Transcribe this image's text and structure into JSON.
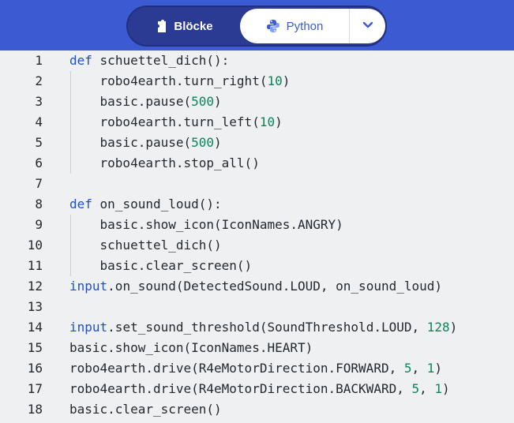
{
  "toolbar": {
    "blocks_label": "Blöcke",
    "python_label": "Python"
  },
  "editor": {
    "lines": [
      {
        "n": "1",
        "i": 0,
        "t": [
          [
            "kw",
            "def"
          ],
          [
            "",
            "schuettel_dich():"
          ]
        ]
      },
      {
        "n": "2",
        "i": 1,
        "t": [
          [
            "",
            "robo4earth.turn_right("
          ],
          [
            "num",
            "10"
          ],
          [
            "",
            ")"
          ]
        ]
      },
      {
        "n": "3",
        "i": 1,
        "t": [
          [
            "",
            "basic.pause("
          ],
          [
            "num",
            "500"
          ],
          [
            "",
            ")"
          ]
        ]
      },
      {
        "n": "4",
        "i": 1,
        "t": [
          [
            "",
            "robo4earth.turn_left("
          ],
          [
            "num",
            "10"
          ],
          [
            "",
            ")"
          ]
        ]
      },
      {
        "n": "5",
        "i": 1,
        "t": [
          [
            "",
            "basic.pause("
          ],
          [
            "num",
            "500"
          ],
          [
            "",
            ")"
          ]
        ]
      },
      {
        "n": "6",
        "i": 1,
        "t": [
          [
            "",
            "robo4earth.stop_all()"
          ]
        ]
      },
      {
        "n": "7",
        "i": 0,
        "t": []
      },
      {
        "n": "8",
        "i": 0,
        "t": [
          [
            "kw",
            "def"
          ],
          [
            "",
            "on_sound_loud():"
          ]
        ]
      },
      {
        "n": "9",
        "i": 1,
        "t": [
          [
            "",
            "basic.show_icon(IconNames.ANGRY)"
          ]
        ]
      },
      {
        "n": "10",
        "i": 1,
        "t": [
          [
            "",
            "schuettel_dich()"
          ]
        ]
      },
      {
        "n": "11",
        "i": 1,
        "t": [
          [
            "",
            "basic.clear_screen()"
          ]
        ]
      },
      {
        "n": "12",
        "i": 0,
        "t": [
          [
            "kw",
            "input"
          ],
          [
            "",
            ".on_sound(DetectedSound.LOUD, on_sound_loud)"
          ]
        ]
      },
      {
        "n": "13",
        "i": 0,
        "t": []
      },
      {
        "n": "14",
        "i": 0,
        "t": [
          [
            "kw",
            "input"
          ],
          [
            "",
            ".set_sound_threshold(SoundThreshold.LOUD, "
          ],
          [
            "num",
            "128"
          ],
          [
            "",
            ")"
          ]
        ]
      },
      {
        "n": "15",
        "i": 0,
        "t": [
          [
            "",
            "basic.show_icon(IconNames.HEART)"
          ]
        ]
      },
      {
        "n": "16",
        "i": 0,
        "t": [
          [
            "",
            "robo4earth.drive(R4eMotorDirection.FORWARD, "
          ],
          [
            "num",
            "5"
          ],
          [
            "",
            ", "
          ],
          [
            "num",
            "1"
          ],
          [
            "",
            ")"
          ]
        ]
      },
      {
        "n": "17",
        "i": 0,
        "t": [
          [
            "",
            "robo4earth.drive(R4eMotorDirection.BACKWARD, "
          ],
          [
            "num",
            "5"
          ],
          [
            "",
            ", "
          ],
          [
            "num",
            "1"
          ],
          [
            "",
            ")"
          ]
        ]
      },
      {
        "n": "18",
        "i": 0,
        "t": [
          [
            "",
            "basic.clear_screen()"
          ]
        ]
      }
    ]
  },
  "colors": {
    "header": "#3c5bd2",
    "toggle": "#2b3a93",
    "keyword": "#1f4fc7",
    "number": "#098658",
    "background": "#eef0f2"
  },
  "icons": {
    "blocks": "puzzle-piece-icon",
    "python": "python-logo-icon",
    "dropdown": "chevron-down-icon"
  }
}
